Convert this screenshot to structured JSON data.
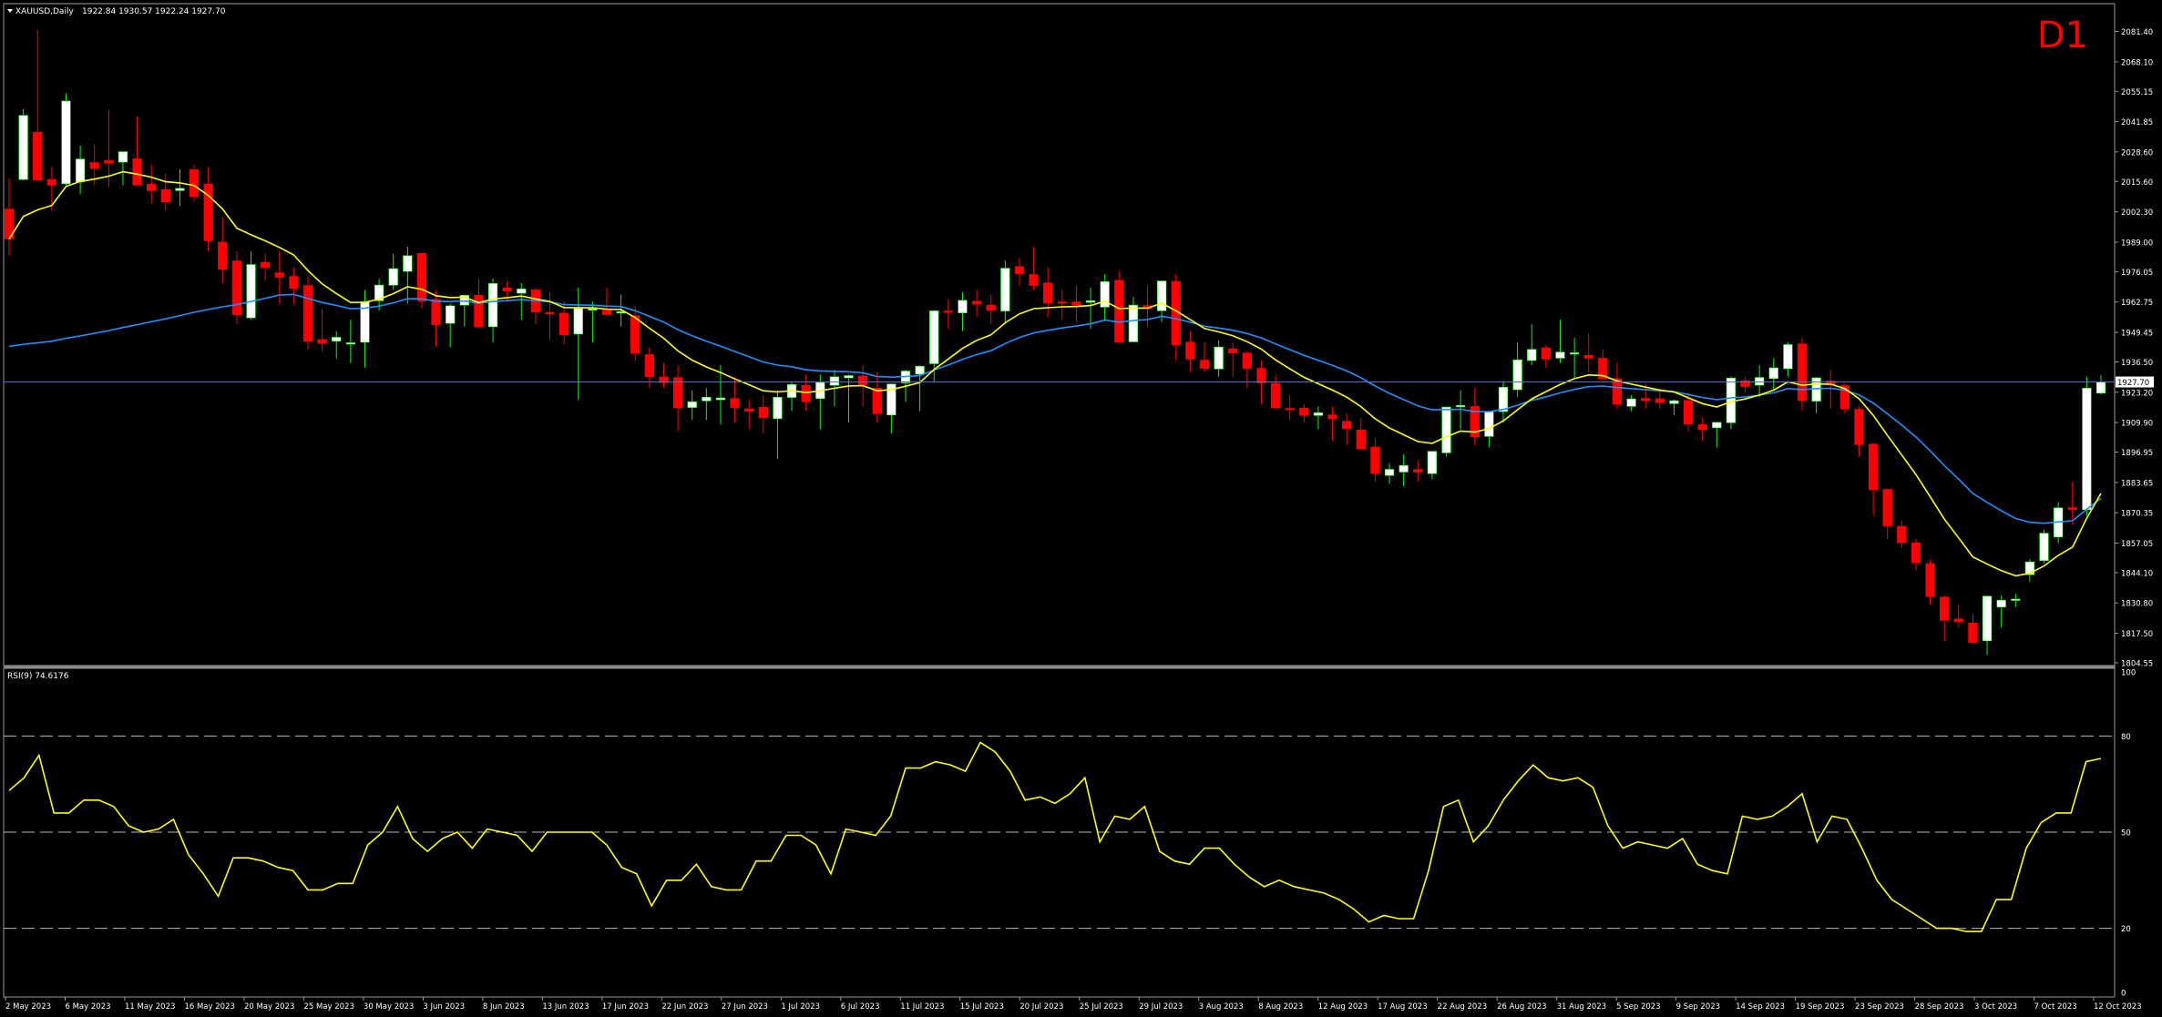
{
  "header": {
    "symbol": "XAUUSD,Daily",
    "ohlc": "1922.84 1930.57 1922.24 1927.70",
    "timeframe": "D1"
  },
  "rsi_header": "RSI(9) 74.6176",
  "colors": {
    "background": "#000000",
    "bull_candle": "#ffffff",
    "bear_candle": "#ff0000",
    "ma_fast": "#ffff00",
    "ma_slow": "#1e90ff",
    "rsi_line": "#ffff00",
    "price_line": "#4f6fbf",
    "timeframe_label": "#ff0000",
    "axis_text": "#ffffff"
  },
  "chart_data": [
    {
      "type": "candlestick",
      "title": "XAUUSD,Daily",
      "current_price": 1927.7,
      "current_price_label": "1927.70",
      "ylim": [
        1804.55,
        2092.0
      ],
      "y_tick_labels": [
        "2081.40",
        "2068.10",
        "2055.15",
        "2041.85",
        "2028.60",
        "2015.60",
        "2002.30",
        "1989.00",
        "1976.05",
        "1962.75",
        "1949.45",
        "1936.50",
        "1923.20",
        "1909.90",
        "1896.95",
        "1883.65",
        "1870.35",
        "1857.05",
        "1844.10",
        "1830.80",
        "1817.50",
        "1804.55"
      ],
      "x_tick_labels": [
        "2 May 2023",
        "6 May 2023",
        "11 May 2023",
        "16 May 2023",
        "20 May 2023",
        "25 May 2023",
        "30 May 2023",
        "3 Jun 2023",
        "8 Jun 2023",
        "13 Jun 2023",
        "17 Jun 2023",
        "22 Jun 2023",
        "27 Jun 2023",
        "1 Jul 2023",
        "6 Jul 2023",
        "11 Jul 2023",
        "15 Jul 2023",
        "20 Jul 2023",
        "25 Jul 2023",
        "29 Jul 2023",
        "3 Aug 2023",
        "8 Aug 2023",
        "12 Aug 2023",
        "17 Aug 2023",
        "22 Aug 2023",
        "26 Aug 2023",
        "31 Aug 2023",
        "5 Sep 2023",
        "9 Sep 2023",
        "14 Sep 2023",
        "19 Sep 2023",
        "23 Sep 2023",
        "28 Sep 2023",
        "3 Oct 2023",
        "7 Oct 2023",
        "12 Oct 2023"
      ],
      "candles": [
        [
          2003.5,
          2017.0,
          1983.0,
          1990.4
        ],
        [
          2016.5,
          2047.5,
          2016.0,
          2044.6
        ],
        [
          2037.2,
          2082.0,
          2028.0,
          2016.2
        ],
        [
          2016.5,
          2022.0,
          2003.0,
          2014.0
        ],
        [
          2014.6,
          2054.3,
          2014.0,
          2050.9
        ],
        [
          2015.4,
          2031.5,
          2010.0,
          2025.5
        ],
        [
          2023.9,
          2032.0,
          2014.0,
          2021.3
        ],
        [
          2024.9,
          2047.0,
          2013.0,
          2023.6
        ],
        [
          2024.1,
          2028.0,
          2014.0,
          2028.7
        ],
        [
          2025.6,
          2044.0,
          2016.0,
          2014.0
        ],
        [
          2014.5,
          2023.0,
          2006.0,
          2011.6
        ],
        [
          2012.1,
          2019.0,
          2003.0,
          2006.6
        ],
        [
          2011.6,
          2021.0,
          2005.0,
          2012.6
        ],
        [
          2020.8,
          2023.0,
          2007.0,
          2008.9
        ],
        [
          2014.5,
          2022.0,
          1985.0,
          1989.6
        ],
        [
          1989.0,
          2000.0,
          1971.0,
          1977.1
        ],
        [
          1980.8,
          1985.0,
          1953.0,
          1957.1
        ],
        [
          1955.8,
          1985.0,
          1955.0,
          1979.2
        ],
        [
          1980.2,
          1984.0,
          1972.0,
          1977.8
        ],
        [
          1975.6,
          1985.0,
          1962.0,
          1973.6
        ],
        [
          1974.0,
          1978.0,
          1962.0,
          1968.6
        ],
        [
          1970.0,
          1974.0,
          1942.0,
          1945.6
        ],
        [
          1946.3,
          1960.0,
          1941.0,
          1944.6
        ],
        [
          1945.6,
          1950.0,
          1938.0,
          1947.3
        ],
        [
          1944.6,
          1955.0,
          1936.0,
          1944.9
        ],
        [
          1945.1,
          1968.0,
          1934.0,
          1963.0
        ],
        [
          1963.3,
          1973.0,
          1959.0,
          1970.2
        ],
        [
          1970.1,
          1984.0,
          1968.0,
          1977.4
        ],
        [
          1976.2,
          1987.0,
          1962.0,
          1983.1
        ],
        [
          1984.1,
          1984.0,
          1960.0,
          1963.2
        ],
        [
          1963.9,
          1968.0,
          1943.0,
          1952.8
        ],
        [
          1953.4,
          1962.0,
          1943.0,
          1961.1
        ],
        [
          1961.4,
          1966.0,
          1952.0,
          1965.7
        ],
        [
          1965.7,
          1973.0,
          1955.0,
          1951.8
        ],
        [
          1951.9,
          1973.0,
          1945.0,
          1970.9
        ],
        [
          1968.9,
          1972.0,
          1963.0,
          1967.6
        ],
        [
          1966.6,
          1971.0,
          1955.0,
          1968.5
        ],
        [
          1968.1,
          1969.0,
          1953.0,
          1958.4
        ],
        [
          1958.2,
          1967.0,
          1946.0,
          1958.0
        ],
        [
          1957.9,
          1963.0,
          1944.0,
          1948.4
        ],
        [
          1948.7,
          1969.0,
          1920.0,
          1960.0
        ],
        [
          1959.2,
          1963.0,
          1945.0,
          1959.8
        ],
        [
          1959.5,
          1969.0,
          1957.0,
          1957.2
        ],
        [
          1958.3,
          1966.0,
          1952.0,
          1958.5
        ],
        [
          1956.8,
          1961.0,
          1937.0,
          1940.2
        ],
        [
          1939.7,
          1943.0,
          1925.0,
          1930.0
        ],
        [
          1929.9,
          1936.0,
          1925.0,
          1927.4
        ],
        [
          1929.6,
          1935.0,
          1906.0,
          1916.3
        ],
        [
          1916.5,
          1924.0,
          1911.0,
          1919.0
        ],
        [
          1919.4,
          1925.0,
          1911.0,
          1921.0
        ],
        [
          1919.9,
          1935.0,
          1909.0,
          1920.7
        ],
        [
          1920.4,
          1930.0,
          1910.0,
          1916.5
        ],
        [
          1915.9,
          1920.0,
          1907.0,
          1914.9
        ],
        [
          1916.6,
          1922.0,
          1905.0,
          1912.0
        ],
        [
          1911.6,
          1924.0,
          1894.0,
          1921.0
        ],
        [
          1920.9,
          1928.0,
          1915.0,
          1926.6
        ],
        [
          1926.2,
          1931.0,
          1915.0,
          1919.0
        ],
        [
          1920.4,
          1931.0,
          1907.0,
          1927.5
        ],
        [
          1926.2,
          1933.0,
          1917.0,
          1930.0
        ],
        [
          1929.5,
          1931.0,
          1910.0,
          1930.5
        ],
        [
          1930.3,
          1935.0,
          1917.0,
          1926.5
        ],
        [
          1925.0,
          1932.0,
          1910.0,
          1913.8
        ],
        [
          1913.2,
          1924.0,
          1905.0,
          1926.8
        ],
        [
          1927.3,
          1933.0,
          1919.0,
          1932.5
        ],
        [
          1931.1,
          1935.0,
          1915.0,
          1934.6
        ],
        [
          1935.7,
          1956.0,
          1928.0,
          1958.9
        ],
        [
          1958.8,
          1964.0,
          1951.0,
          1958.5
        ],
        [
          1958.0,
          1967.0,
          1950.0,
          1963.5
        ],
        [
          1963.1,
          1968.0,
          1956.0,
          1961.8
        ],
        [
          1961.4,
          1966.0,
          1953.0,
          1959.1
        ],
        [
          1958.8,
          1981.0,
          1953.0,
          1977.6
        ],
        [
          1978.3,
          1982.0,
          1970.0,
          1975.2
        ],
        [
          1974.8,
          1987.0,
          1968.0,
          1970.0
        ],
        [
          1971.1,
          1978.0,
          1956.0,
          1962.2
        ],
        [
          1962.8,
          1968.0,
          1955.0,
          1962.3
        ],
        [
          1962.8,
          1970.0,
          1954.0,
          1961.3
        ],
        [
          1962.6,
          1969.0,
          1951.0,
          1963.3
        ],
        [
          1960.5,
          1975.0,
          1955.0,
          1971.7
        ],
        [
          1972.3,
          1976.0,
          1960.0,
          1945.1
        ],
        [
          1945.3,
          1965.0,
          1945.0,
          1961.4
        ],
        [
          1961.2,
          1970.0,
          1952.0,
          1959.8
        ],
        [
          1958.9,
          1972.0,
          1954.0,
          1972.0
        ],
        [
          1971.8,
          1975.0,
          1937.0,
          1943.9
        ],
        [
          1945.2,
          1950.0,
          1932.0,
          1937.7
        ],
        [
          1937.3,
          1945.0,
          1932.0,
          1933.6
        ],
        [
          1933.4,
          1946.0,
          1930.0,
          1943.0
        ],
        [
          1942.2,
          1945.0,
          1930.0,
          1940.4
        ],
        [
          1940.4,
          1941.0,
          1925.0,
          1933.6
        ],
        [
          1933.7,
          1937.0,
          1918.0,
          1927.3
        ],
        [
          1927.1,
          1931.0,
          1917.0,
          1916.3
        ],
        [
          1916.1,
          1922.0,
          1911.0,
          1915.8
        ],
        [
          1916.2,
          1918.0,
          1910.0,
          1913.0
        ],
        [
          1913.0,
          1917.0,
          1907.0,
          1914.2
        ],
        [
          1913.3,
          1917.0,
          1902.0,
          1911.5
        ],
        [
          1910.4,
          1914.0,
          1900.0,
          1907.2
        ],
        [
          1906.6,
          1912.0,
          1898.0,
          1898.3
        ],
        [
          1899.2,
          1903.0,
          1884.0,
          1887.5
        ],
        [
          1886.7,
          1892.0,
          1883.0,
          1889.4
        ],
        [
          1888.2,
          1896.0,
          1882.0,
          1891.1
        ],
        [
          1889.3,
          1893.0,
          1884.0,
          1888.2
        ],
        [
          1887.5,
          1897.0,
          1885.0,
          1897.3
        ],
        [
          1896.6,
          1916.0,
          1895.0,
          1916.7
        ],
        [
          1917.2,
          1924.0,
          1907.0,
          1917.4
        ],
        [
          1917.0,
          1925.0,
          1900.0,
          1903.6
        ],
        [
          1903.8,
          1914.0,
          1899.0,
          1914.6
        ],
        [
          1914.7,
          1928.0,
          1910.0,
          1925.4
        ],
        [
          1924.3,
          1945.0,
          1921.0,
          1937.4
        ],
        [
          1937.1,
          1953.0,
          1935.0,
          1942.0
        ],
        [
          1942.7,
          1944.0,
          1934.0,
          1937.7
        ],
        [
          1938.1,
          1955.0,
          1936.0,
          1940.8
        ],
        [
          1940.1,
          1947.0,
          1929.0,
          1940.5
        ],
        [
          1939.4,
          1949.0,
          1932.0,
          1938.1
        ],
        [
          1938.1,
          1942.0,
          1930.0,
          1929.0
        ],
        [
          1929.2,
          1936.0,
          1916.0,
          1917.9
        ],
        [
          1917.0,
          1922.0,
          1915.0,
          1920.3
        ],
        [
          1920.5,
          1927.0,
          1916.0,
          1919.5
        ],
        [
          1920.3,
          1925.0,
          1916.0,
          1918.6
        ],
        [
          1918.2,
          1920.0,
          1913.0,
          1919.5
        ],
        [
          1919.6,
          1923.0,
          1906.0,
          1909.2
        ],
        [
          1909.0,
          1912.0,
          1902.0,
          1906.8
        ],
        [
          1907.6,
          1910.0,
          1899.0,
          1910.0
        ],
        [
          1909.8,
          1930.0,
          1907.0,
          1929.4
        ],
        [
          1928.3,
          1930.0,
          1923.0,
          1925.7
        ],
        [
          1926.3,
          1935.0,
          1921.0,
          1929.7
        ],
        [
          1929.2,
          1938.0,
          1924.0,
          1933.9
        ],
        [
          1933.5,
          1945.0,
          1930.0,
          1944.1
        ],
        [
          1944.4,
          1947.0,
          1915.0,
          1919.5
        ],
        [
          1919.3,
          1930.0,
          1914.0,
          1929.5
        ],
        [
          1928.1,
          1933.0,
          1916.0,
          1926.4
        ],
        [
          1926.1,
          1927.0,
          1914.0,
          1915.9
        ],
        [
          1915.7,
          1917.0,
          1895.0,
          1900.2
        ],
        [
          1900.4,
          1901.0,
          1869.0,
          1880.4
        ],
        [
          1880.6,
          1881.0,
          1859.0,
          1864.5
        ],
        [
          1864.4,
          1867.0,
          1855.0,
          1857.2
        ],
        [
          1857.2,
          1859.0,
          1845.0,
          1848.4
        ],
        [
          1848.0,
          1850.0,
          1830.0,
          1833.6
        ],
        [
          1833.4,
          1834.0,
          1814.0,
          1823.2
        ],
        [
          1823.8,
          1830.0,
          1820.0,
          1822.5
        ],
        [
          1822.0,
          1826.0,
          1813.0,
          1813.4
        ],
        [
          1814.2,
          1834.0,
          1808.0,
          1833.8
        ],
        [
          1829.0,
          1834.0,
          1820.0,
          1832.0
        ],
        [
          1832.0,
          1835.0,
          1829.0,
          1832.5
        ],
        [
          1843.2,
          1850.0,
          1840.0,
          1848.8
        ],
        [
          1849.4,
          1863.0,
          1848.0,
          1861.4
        ],
        [
          1859.7,
          1875.0,
          1857.0,
          1872.5
        ],
        [
          1872.6,
          1884.0,
          1865.0,
          1871.8
        ],
        [
          1871.7,
          1930.0,
          1869.0,
          1925.0
        ],
        [
          1922.8,
          1930.6,
          1922.2,
          1927.7
        ]
      ],
      "series": [
        {
          "indicator": "moving average (fast)",
          "color": "#ffff00"
        },
        {
          "indicator": "moving average (slow)",
          "color": "#1e90ff"
        }
      ]
    },
    {
      "type": "line",
      "title": "RSI(9) 74.6176",
      "ylim": [
        0,
        100
      ],
      "y_tick_labels": [
        "100",
        "80",
        "50",
        "20",
        "0"
      ],
      "levels": [
        80,
        50,
        20
      ],
      "values": [
        63,
        67,
        74,
        56,
        56,
        60,
        60,
        58,
        52,
        50,
        51,
        54,
        43,
        37,
        30,
        42,
        42,
        41,
        39,
        38,
        32,
        32,
        34,
        34,
        46,
        50,
        58,
        48,
        44,
        48,
        50,
        45,
        51,
        50,
        49,
        44,
        50,
        50,
        50,
        50,
        46,
        39,
        37,
        27,
        35,
        35,
        40,
        33,
        32,
        32,
        41,
        41,
        49,
        49,
        46,
        37,
        51,
        50,
        49,
        55,
        70,
        70,
        72,
        71,
        69,
        78,
        75,
        69,
        60,
        61,
        59,
        62,
        67,
        47,
        55,
        54,
        58,
        44,
        41,
        40,
        45,
        45,
        40,
        36,
        33,
        35,
        33,
        32,
        31,
        29,
        26,
        22,
        24,
        23,
        23,
        38,
        58,
        60,
        47,
        52,
        60,
        66,
        71,
        67,
        66,
        67,
        64,
        52,
        45,
        47,
        46,
        45,
        48,
        40,
        38,
        37,
        55,
        54,
        55,
        58,
        62,
        47,
        55,
        54,
        45,
        35,
        29,
        26,
        23,
        20,
        20,
        19,
        19,
        29,
        29,
        45,
        53,
        56,
        56,
        72,
        73
      ]
    }
  ]
}
